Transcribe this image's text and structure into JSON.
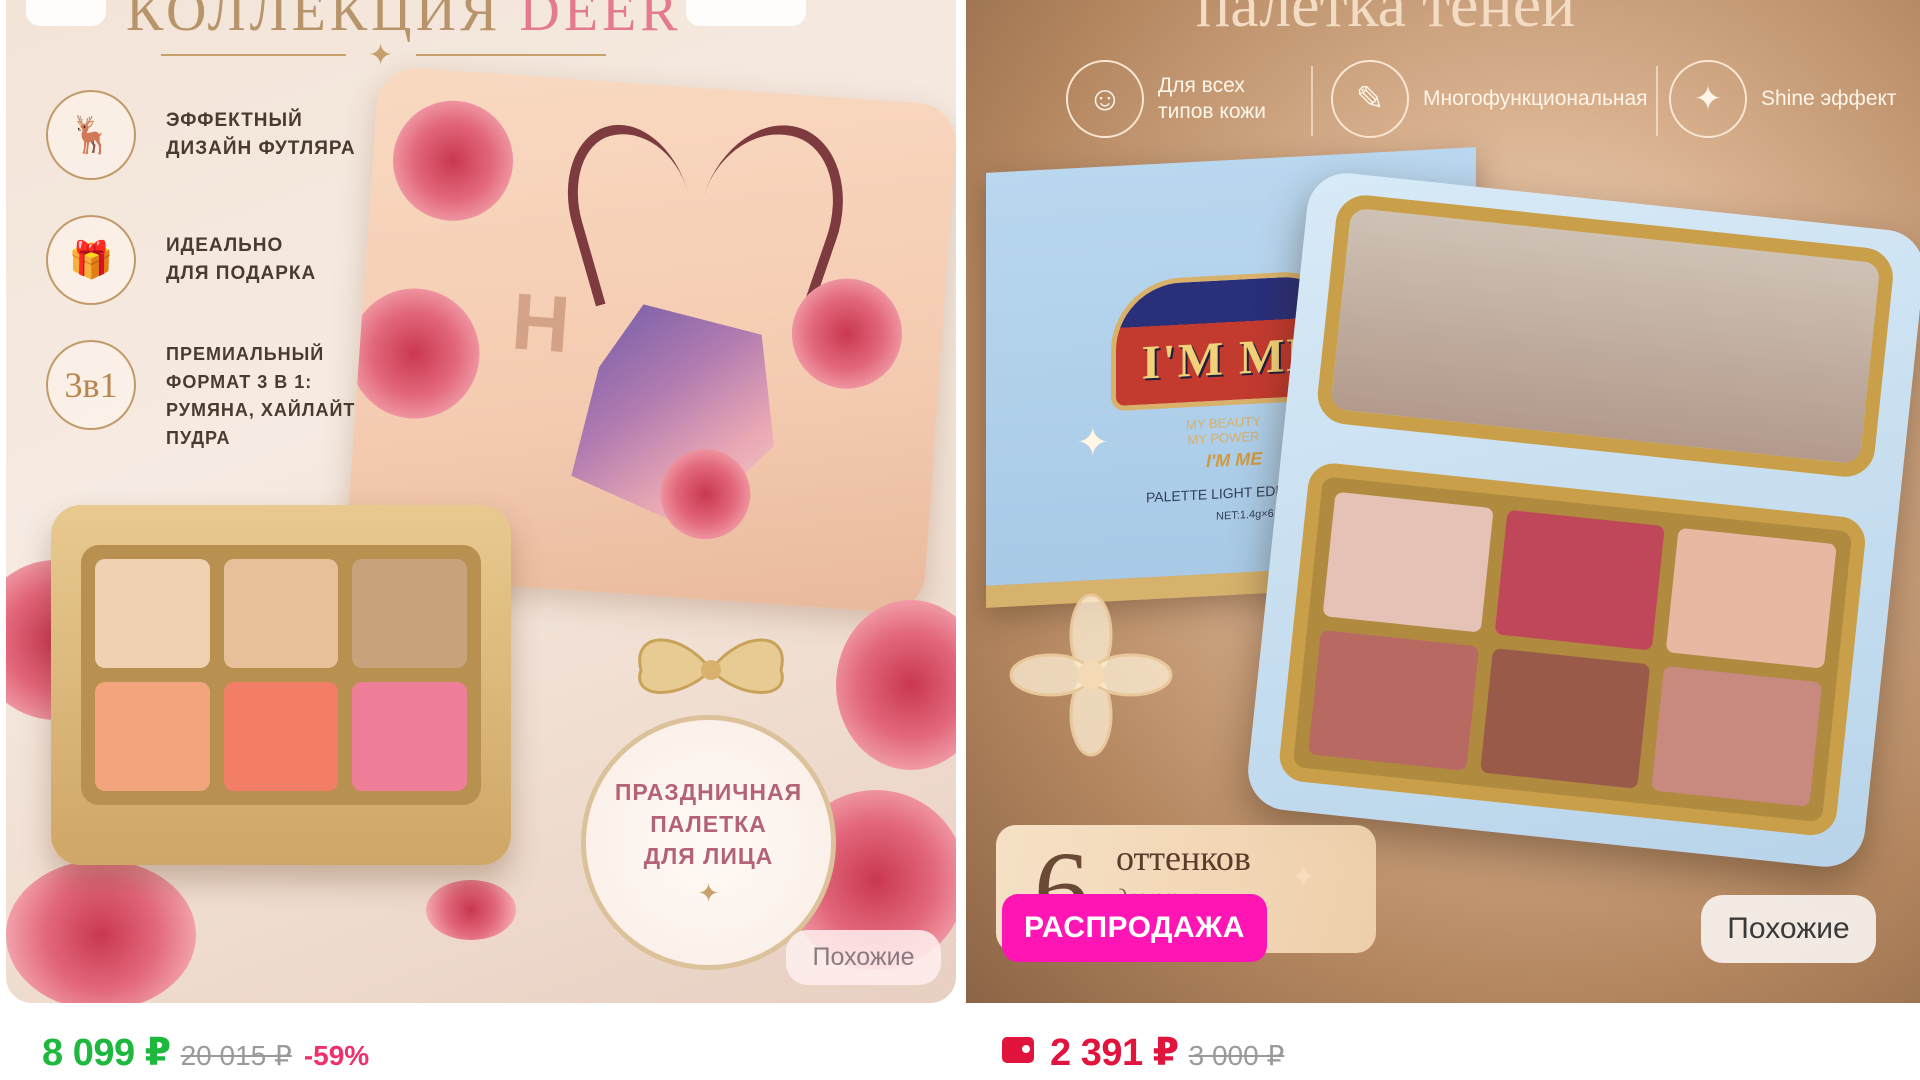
{
  "colors": {
    "price_green": "#1fb83f",
    "price_red": "#e0143c",
    "discount_pink": "#f0306a",
    "sale_badge": "#ff14b4",
    "similar_button_bg": "#ffffff"
  },
  "products": [
    {
      "banner_title_main": "КОЛЛЕКЦИЯ",
      "banner_title_accent": "DEER",
      "features": [
        {
          "icon": "deer-icon",
          "glyph": "🦌",
          "text": "ЭФФЕКТНЫЙ\nДИЗАЙН ФУТЛЯРА"
        },
        {
          "icon": "gift-icon",
          "glyph": "🎁",
          "text": "ИДЕАЛЬНО\nДЛЯ ПОДАРКА"
        },
        {
          "icon": "three-in-one-icon",
          "glyph": "3в1",
          "text": "ПРЕМИАЛЬНЫЙ\nФОРМАТ 3 В 1:\nРУМЯНА, ХАЙЛАЙТЕР,\nПУДРА"
        }
      ],
      "tag_text": "ПРАЗДНИЧНАЯ\nПАЛЕТКА\nДЛЯ ЛИЦА",
      "similar_label": "Похожие",
      "price_current": "8 099 ₽",
      "price_old": "20 015 ₽",
      "discount": "-59%",
      "shade_colors": [
        "#f0d2b2",
        "#e7c09a",
        "#c8a27a",
        "#f2a57d",
        "#f27e68",
        "#ef7e98"
      ]
    },
    {
      "banner_title": "палетка теней",
      "features": [
        {
          "icon": "face-icon",
          "glyph": "☺",
          "text": "Для всех\nтипов кожи"
        },
        {
          "icon": "brushes-icon",
          "glyph": "✎",
          "text": "Многофункциональная"
        },
        {
          "icon": "sparkle-icon",
          "glyph": "✦",
          "text": "Shine эффект"
        }
      ],
      "box_logo": "I'M ME",
      "box_tagline": "MY BEAUTY\nMY POWER",
      "box_brand_small": "I'M ME",
      "box_edit": "PALETTE LIGHT EDIT UNLOCKED",
      "box_net": "NET:1.4g×6",
      "shades_number": "6",
      "shades_word": "оттенков",
      "shades_small": "для стильных\nобразов",
      "sale_label": "РАСПРОДАЖА",
      "similar_label": "Похожие",
      "price_current": "2 391 ₽",
      "price_old": "3 000 ₽",
      "shade_colors": [
        "#e6c2b6",
        "#c0475a",
        "#e8b8a2",
        "#b86a62",
        "#9a5a4a",
        "#c8897f"
      ]
    }
  ]
}
